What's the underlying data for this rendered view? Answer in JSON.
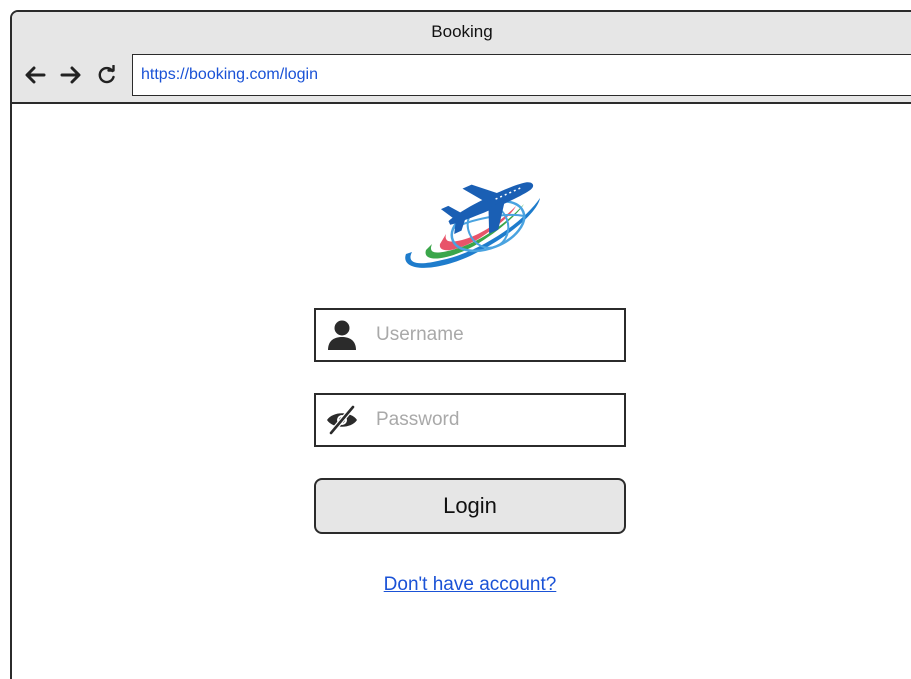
{
  "window": {
    "title": "Booking"
  },
  "toolbar": {
    "back_icon": "arrow-left-icon",
    "forward_icon": "arrow-right-icon",
    "reload_icon": "reload-icon",
    "url": "https://booking.com/login"
  },
  "logo": {
    "icon": "airplane-globe-logo",
    "colors": {
      "blue": "#1e78c8",
      "green": "#3aa64a",
      "red": "#e8546a",
      "plane": "#1a5fb4"
    }
  },
  "form": {
    "username": {
      "icon": "user-icon",
      "placeholder": "Username",
      "value": ""
    },
    "password": {
      "icon": "eye-slash-icon",
      "placeholder": "Password",
      "value": ""
    },
    "login_label": "Login",
    "signup_link": "Don't have account?"
  },
  "colors": {
    "link": "#1a52d6",
    "chrome_bg": "#e6e6e6",
    "border": "#2b2b2b"
  }
}
